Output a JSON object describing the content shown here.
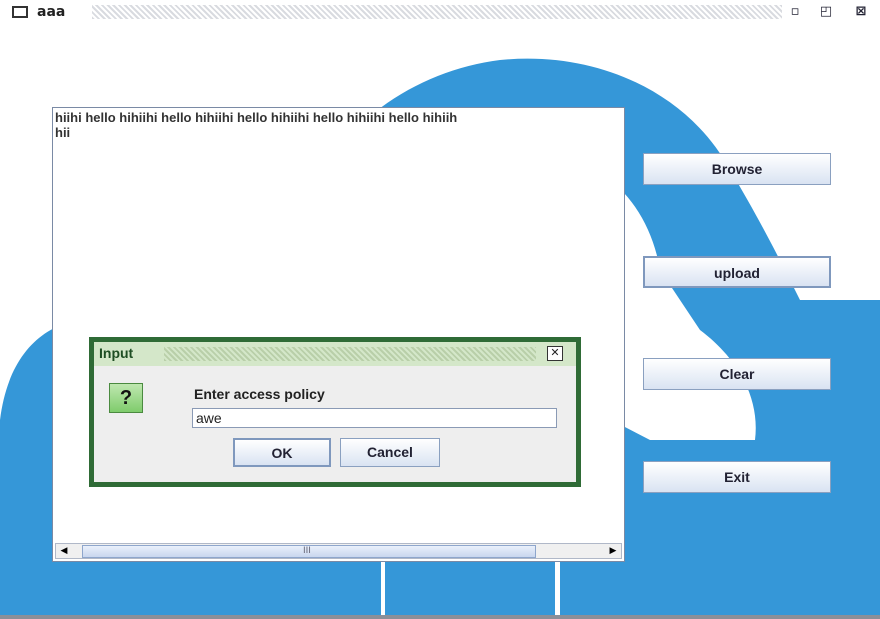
{
  "window": {
    "title": "aaa",
    "controls": {
      "minimize_icon": "minimize-icon",
      "maximize_icon": "maximize-icon",
      "close_icon": "close-icon"
    }
  },
  "textarea": {
    "line1": "hiihi hello hihiihi hello hihiihi hello hihiihi hello hihiihi hello hihiih",
    "line2": "hii"
  },
  "buttons": {
    "browse": "Browse",
    "upload": "upload",
    "clear": "Clear",
    "exit": "Exit"
  },
  "dialog": {
    "title": "Input",
    "prompt": "Enter access policy",
    "value": "awe",
    "ok": "OK",
    "cancel": "Cancel",
    "icon": "question-icon",
    "icon_glyph": "?"
  },
  "colors": {
    "cloud": "#3597d8",
    "dialog_border": "#2f6b36"
  }
}
